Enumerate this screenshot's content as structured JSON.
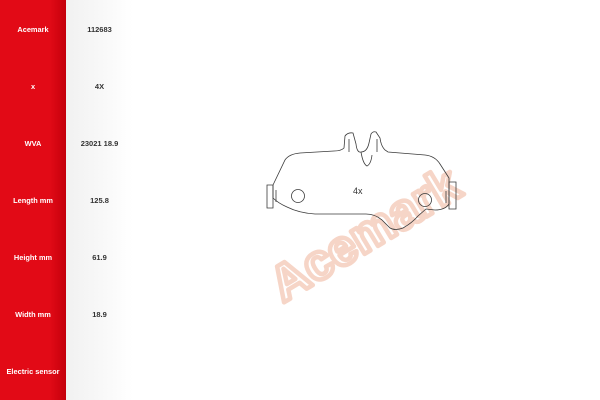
{
  "product_specs": {
    "rows": [
      {
        "label": "Acemark",
        "value": "112683"
      },
      {
        "label": "x",
        "value": "4X"
      },
      {
        "label": "WVA",
        "value": "23021 18.9"
      },
      {
        "label": "Length mm",
        "value": "125.8"
      },
      {
        "label": "Height mm",
        "value": "61.9"
      },
      {
        "label": "Width mm",
        "value": "18.9"
      },
      {
        "label": "Electric sensor",
        "value": ""
      }
    ]
  },
  "drawing": {
    "quantity_mark": "4x",
    "watermark_text": "Acemark",
    "watermark_color": "#f0b39a",
    "accent_color": "#e20a16"
  }
}
